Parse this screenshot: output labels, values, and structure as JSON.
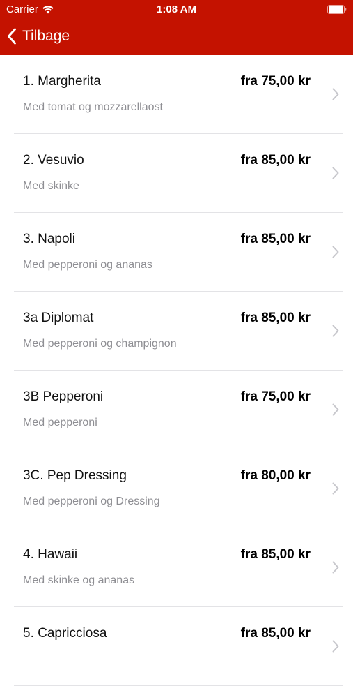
{
  "status_bar": {
    "carrier": "Carrier",
    "time": "1:08 AM"
  },
  "nav": {
    "back_label": "Tilbage"
  },
  "colors": {
    "header_bg": "#c41200",
    "chevron": "#c7c7cc",
    "description": "#8e8e93"
  },
  "items": [
    {
      "name": "1. Margherita",
      "price": "fra 75,00 kr",
      "description": "Med tomat og mozzarellaost"
    },
    {
      "name": "2. Vesuvio",
      "price": "fra 85,00 kr",
      "description": "Med skinke"
    },
    {
      "name": "3. Napoli",
      "price": "fra 85,00 kr",
      "description": "Med pepperoni og ananas"
    },
    {
      "name": "3a Diplomat",
      "price": "fra 85,00 kr",
      "description": "Med pepperoni og champignon"
    },
    {
      "name": "3B Pepperoni",
      "price": "fra 75,00 kr",
      "description": "Med pepperoni"
    },
    {
      "name": "3C. Pep Dressing",
      "price": "fra 80,00 kr",
      "description": "Med pepperoni og Dressing"
    },
    {
      "name": "4. Hawaii",
      "price": "fra 85,00 kr",
      "description": "Med skinke og ananas"
    },
    {
      "name": "5. Capricciosa",
      "price": "fra 85,00 kr",
      "description": ""
    }
  ]
}
